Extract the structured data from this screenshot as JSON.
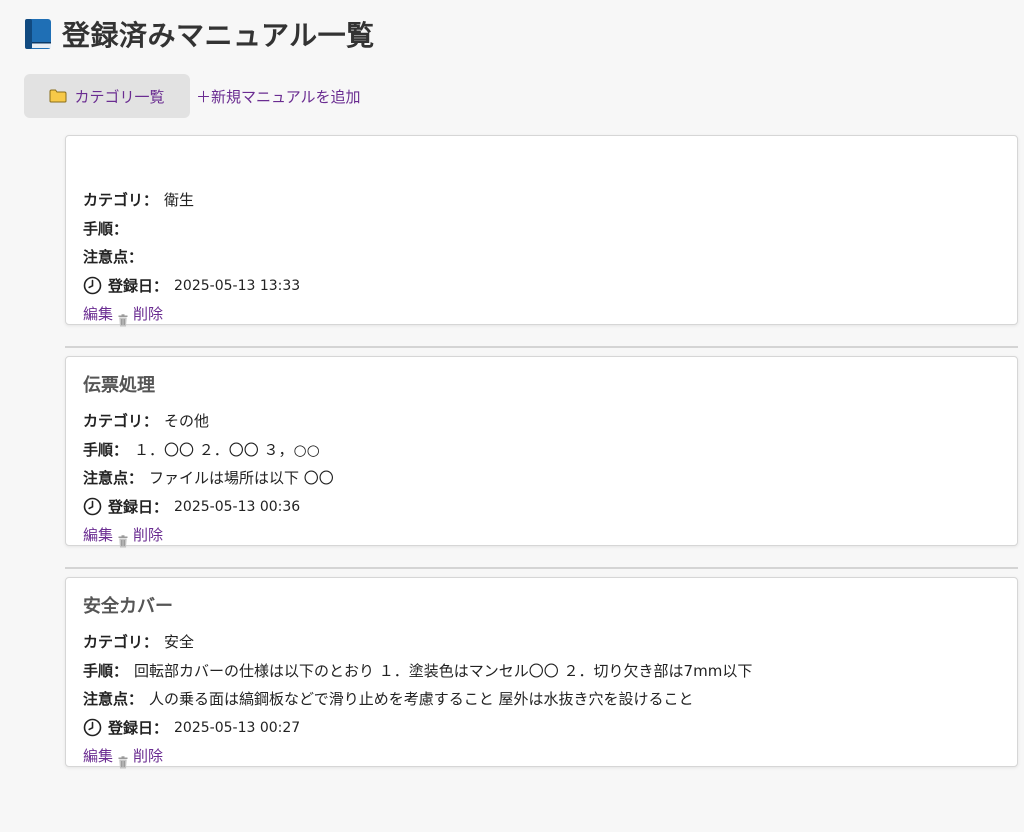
{
  "header": {
    "title": "登録済みマニュアル一覧",
    "icon": "book-icon"
  },
  "nav": {
    "category_button": "カテゴリ一覧",
    "add_link": "＋新規マニュアルを追加"
  },
  "labels": {
    "category": "カテゴリ：",
    "steps": "手順：",
    "notes": "注意点：",
    "registered": "登録日："
  },
  "actions": {
    "edit": "編集",
    "delete": "削除"
  },
  "manuals": [
    {
      "title": "",
      "category": "衛生",
      "steps": "",
      "notes": "",
      "registered": "2025-05-13 13:33"
    },
    {
      "title": "伝票処理",
      "category": "その他",
      "steps": "１．〇〇 ２．〇〇 ３，○○",
      "notes": "ファイルは場所は以下 〇〇",
      "registered": "2025-05-13 00:36"
    },
    {
      "title": "安全カバー",
      "category": "安全",
      "steps": "回転部カバーの仕様は以下のとおり １．塗装色はマンセル〇〇 ２．切り欠き部は7mm以下",
      "notes": "人の乗る面は縞鋼板などで滑り止めを考慮すること 屋外は水抜き穴を設けること",
      "registered": "2025-05-13 00:27"
    }
  ],
  "colors": {
    "link": "#6a2c91",
    "background": "#f7f7f7",
    "card": "#ffffff"
  }
}
